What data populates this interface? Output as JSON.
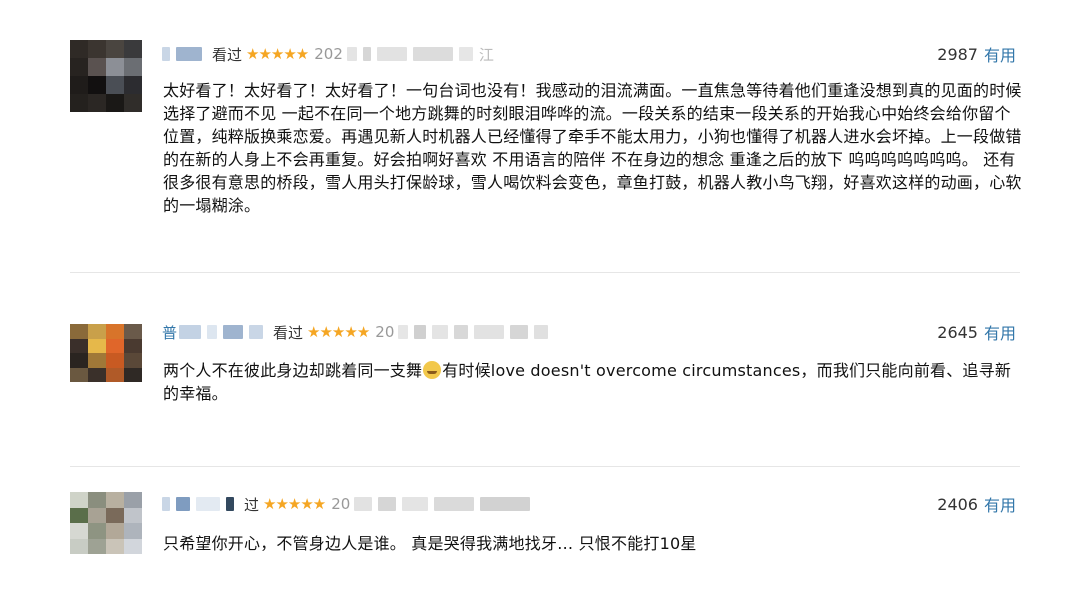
{
  "reviews": [
    {
      "name_visible": "",
      "watched_label": "看过",
      "stars": "★★★★★",
      "date_prefix": "202",
      "location_suffix": "江",
      "vote_count": "2987",
      "useful_label": "有用",
      "content": "太好看了！太好看了！太好看了！一句台词也没有！我感动的泪流满面。一直焦急等待着他们重逢没想到真的见面的时候选择了避而不见 一起不在同一个地方跳舞的时刻眼泪哗哗的流。一段关系的结束一段关系的开始我心中始终会给你留个位置，纯粹版换乘恋爱。再遇见新人时机器人已经懂得了牵手不能太用力，小狗也懂得了机器人进水会坏掉。上一段做错的在新的人身上不会再重复。好会拍啊好喜欢 不用语言的陪伴 不在身边的想念 重逢之后的放下 呜呜呜呜呜呜呜。 还有很多很有意思的桥段，雪人用头打保龄球，雪人喝饮料会变色，章鱼打鼓，机器人教小鸟飞翔，好喜欢这样的动画，心软的一塌糊涂。"
    },
    {
      "name_visible": "普",
      "watched_label": "看过",
      "stars": "★★★★★",
      "date_prefix": "20",
      "location_suffix": "",
      "vote_count": "2645",
      "useful_label": "有用",
      "content_before_emoji": "两个人不在彼此身边却跳着同一支舞",
      "content_after_emoji": "有时候love doesn't overcome circumstances，而我们只能向前看、追寻新的幸福。"
    },
    {
      "name_visible": "",
      "watched_label": "过",
      "stars": "★★★★★",
      "date_prefix": "20",
      "location_suffix": "",
      "vote_count": "2406",
      "useful_label": "有用",
      "content": "只希望你开心，不管身边人是谁。 真是哭得我满地找牙… 只恨不能打10星"
    }
  ]
}
